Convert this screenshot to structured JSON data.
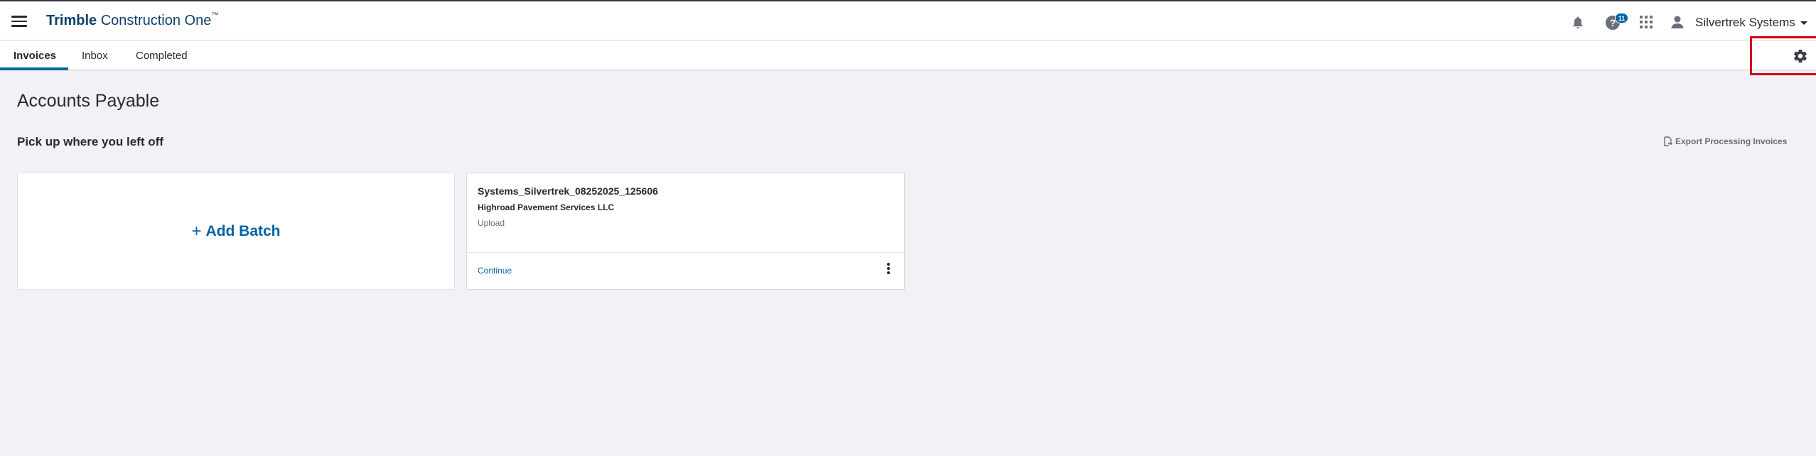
{
  "header": {
    "brand_strong": "Trimble",
    "brand_light": " Construction One",
    "brand_tm": "™",
    "help_badge_count": "11",
    "account_name": "Silvertrek Systems",
    "icons": [
      "menu-icon",
      "bell-icon",
      "help-icon",
      "apps-grid-icon",
      "user-icon",
      "caret-down-icon"
    ]
  },
  "tabs": [
    {
      "label": "Invoices",
      "active": true
    },
    {
      "label": "Inbox",
      "active": false
    },
    {
      "label": "Completed",
      "active": false
    }
  ],
  "settings": {
    "icon": "gear-icon",
    "highlight_color": "#d0021b"
  },
  "main": {
    "page_title": "Accounts Payable",
    "section_title": "Pick up where you left off",
    "export_label": "Export Processing Invoices",
    "add_batch_plus": "+",
    "add_batch_label": "Add Batch",
    "batch": {
      "name": "Systems_Silvertrek_08252025_125606",
      "vendor": "Highroad Pavement Services LLC",
      "status": "Upload",
      "continue_label": "Continue"
    }
  },
  "colors": {
    "accent": "#0063a3",
    "brand": "#0e416c",
    "background": "#f1f1f6"
  }
}
